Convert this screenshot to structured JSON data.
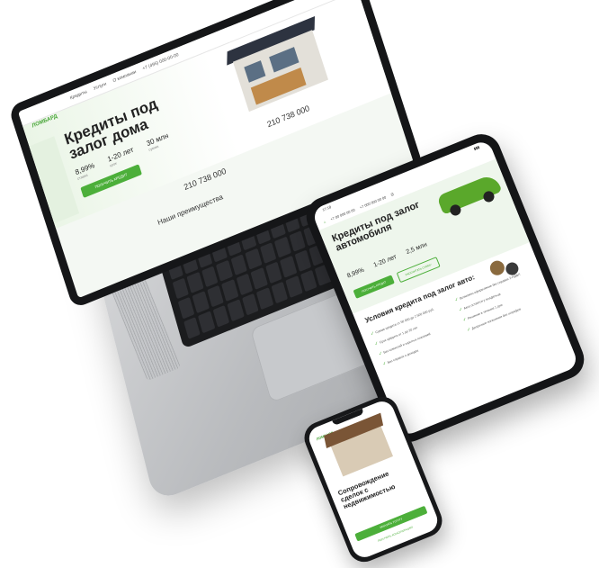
{
  "laptop": {
    "logo": "ЛОМБАРД",
    "nav": [
      "Кредиты",
      "Услуги",
      "О компании",
      "+7 (495) 000-00-00"
    ],
    "hero_title": "Кредиты под залог дома",
    "stats": [
      {
        "value": "8,99%",
        "label": "ставка"
      },
      {
        "value": "1-20 лет",
        "label": "срок"
      },
      {
        "value": "30 млн",
        "label": "сумма"
      }
    ],
    "cta": "ПОЛУЧИТЬ КРЕДИТ",
    "amount_1": "210 738 000",
    "amount_2": "210 738 000",
    "section_title": "Наши преимущества"
  },
  "tablet": {
    "status_time": "17:18",
    "phone_1": "+7 00 000 00 00",
    "phone_2": "+7 000 000 00 00",
    "hero_title": "Кредиты под залог автомобиля",
    "stats": [
      {
        "value": "8,99%"
      },
      {
        "value": "1-20 лет"
      },
      {
        "value": "2,5 млн"
      }
    ],
    "btn_primary": "ПОЛУЧИТЬ КРЕДИТ",
    "btn_secondary": "РАССЧИТАТЬ СУММУ",
    "conditions_title": "Условия кредита под залог авто:",
    "conditions": [
      "Сумма кредита от 50 000 до 2 500 000 руб.",
      "Возможно оформление без справки 2-НДФЛ",
      "Срок кредита от 1 до 20 лет",
      "Авто остается у владельца",
      "Без комиссий и скрытых платежей",
      "Решение в течение 1 дня",
      "Без справок о доходах",
      "Досрочное погашение без штрафов"
    ]
  },
  "phone": {
    "logo": "ЛОМБАРД",
    "hero_title": "Сопровождение сделок с недвижимостью",
    "btn_primary": "ЗАКАЗАТЬ УСЛУГУ",
    "btn_secondary": "ПОЛУЧИТЬ КОНСУЛЬТАЦИЮ"
  }
}
